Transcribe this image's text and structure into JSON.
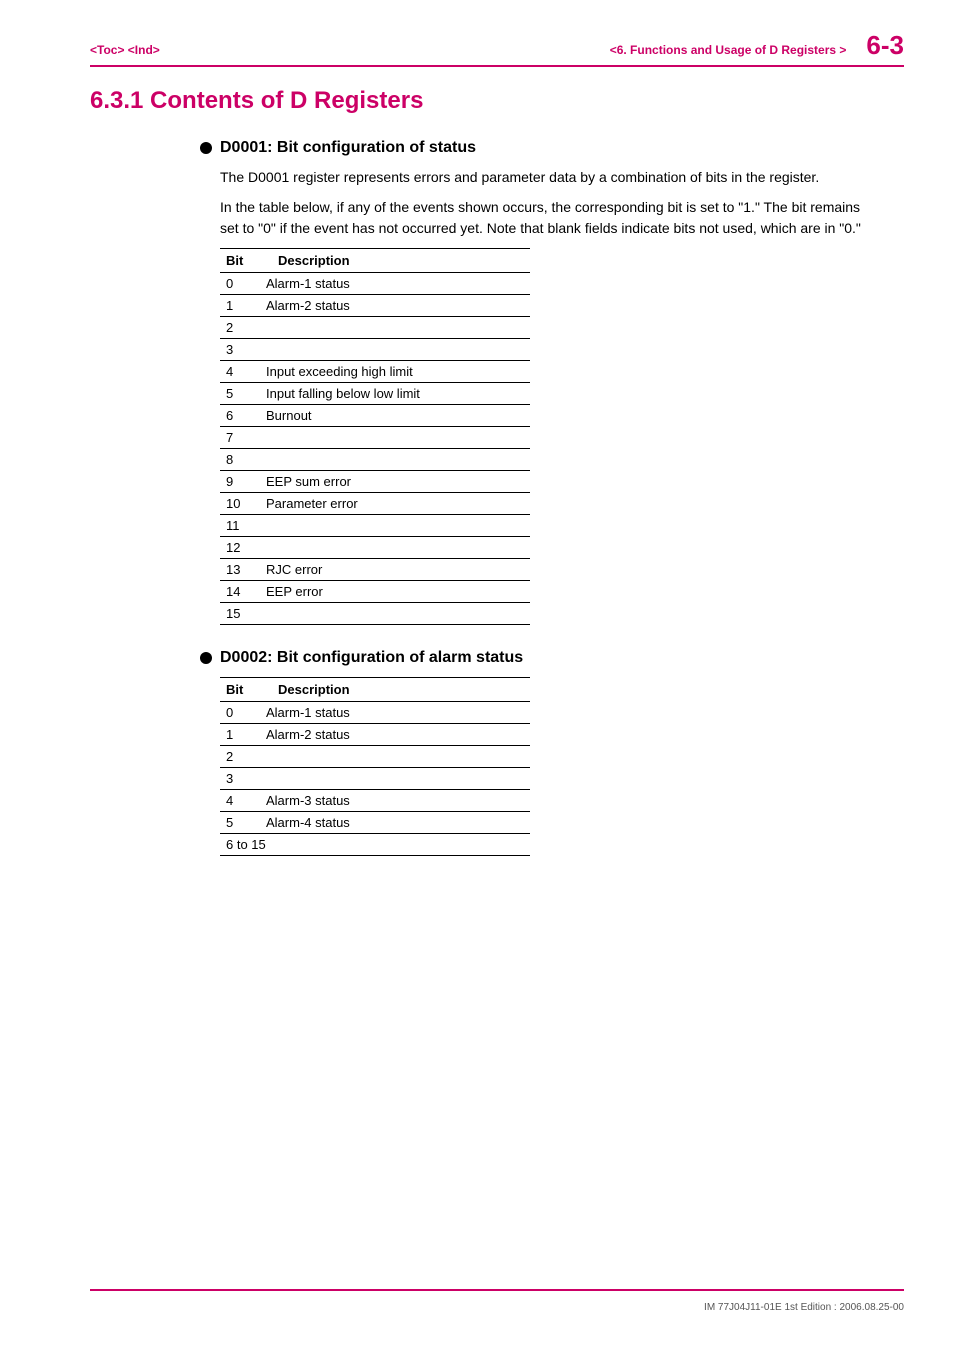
{
  "header": {
    "left": "<Toc> <Ind>",
    "mid": "<6.  Functions and Usage of D Registers >",
    "pagenum": "6-3"
  },
  "title": "6.3.1    Contents of D Registers",
  "section1": {
    "heading": "D0001: Bit configuration of status",
    "para1": "The D0001 register represents errors and parameter data by a combination of bits in the register.",
    "para2": "In the table below, if any of the events shown occurs, the corresponding bit is set to \"1.\" The bit remains set to \"0\" if the event has not occurred yet. Note that blank fields indicate bits not used, which are in \"0.\"",
    "table": {
      "head_bit": "Bit",
      "head_desc": "Description",
      "rows": [
        {
          "bit": "0",
          "desc": "Alarm-1 status"
        },
        {
          "bit": "1",
          "desc": "Alarm-2 status"
        },
        {
          "bit": "2",
          "desc": ""
        },
        {
          "bit": "3",
          "desc": ""
        },
        {
          "bit": "4",
          "desc": "Input exceeding high limit"
        },
        {
          "bit": "5",
          "desc": "Input falling below low limit"
        },
        {
          "bit": "6",
          "desc": "Burnout"
        },
        {
          "bit": "7",
          "desc": ""
        },
        {
          "bit": "8",
          "desc": ""
        },
        {
          "bit": "9",
          "desc": "EEP sum error"
        },
        {
          "bit": "10",
          "desc": "Parameter error"
        },
        {
          "bit": "11",
          "desc": ""
        },
        {
          "bit": "12",
          "desc": ""
        },
        {
          "bit": "13",
          "desc": "RJC error"
        },
        {
          "bit": "14",
          "desc": "EEP error"
        },
        {
          "bit": "15",
          "desc": ""
        }
      ]
    }
  },
  "section2": {
    "heading": "D0002: Bit configuration of alarm status",
    "table": {
      "head_bit": "Bit",
      "head_desc": "Description",
      "rows": [
        {
          "bit": "0",
          "desc": "Alarm-1 status"
        },
        {
          "bit": "1",
          "desc": "Alarm-2 status"
        },
        {
          "bit": "2",
          "desc": ""
        },
        {
          "bit": "3",
          "desc": ""
        },
        {
          "bit": "4",
          "desc": "Alarm-3 status"
        },
        {
          "bit": "5",
          "desc": "Alarm-4 status"
        },
        {
          "bit": "6 to 15",
          "desc": ""
        }
      ]
    }
  },
  "footer": "IM 77J04J11-01E  1st Edition : 2006.08.25-00"
}
